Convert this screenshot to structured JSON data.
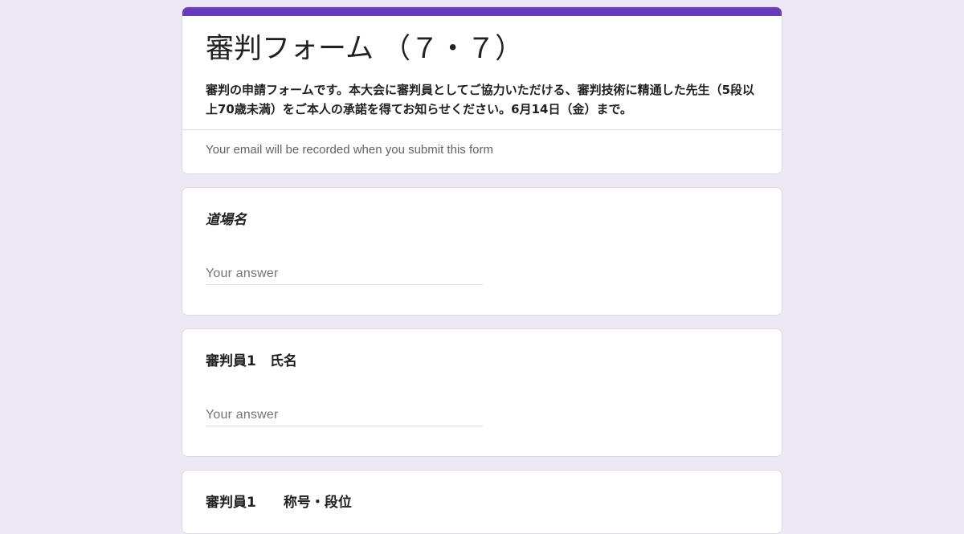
{
  "theme": {
    "accent": "#673ab7",
    "background": "#ede7f6"
  },
  "header": {
    "title": "審判フォーム （７・７）",
    "description": "審判の申請フォームです。本大会に審判員としてご協力いただける、審判技術に精通した先生（5段以上70歳未満）をご本人の承諾を得てお知らせください。6月14日（金）まで。",
    "email_notice": "Your email will be recorded when you submit this form"
  },
  "questions": [
    {
      "title": "道場名",
      "placeholder": "Your answer"
    },
    {
      "title": "審判員1　氏名",
      "placeholder": "Your answer"
    },
    {
      "title": "審判員1　　称号・段位"
    }
  ]
}
